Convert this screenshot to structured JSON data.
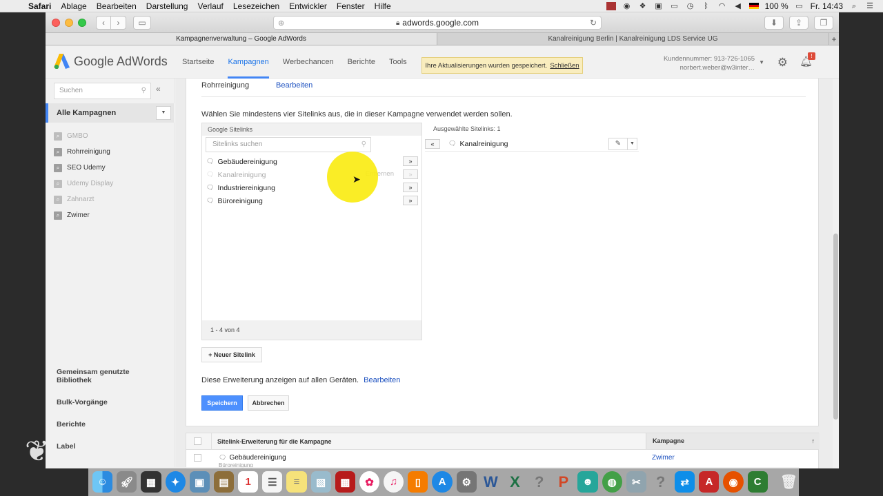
{
  "menubar": {
    "items": [
      "Safari",
      "Ablage",
      "Bearbeiten",
      "Darstellung",
      "Verlauf",
      "Lesezeichen",
      "Entwickler",
      "Fenster",
      "Hilfe"
    ],
    "battery": "100 %",
    "clock": "Fr. 14:43"
  },
  "browser": {
    "url": "adwords.google.com",
    "tabs": [
      {
        "title": "Kampagnenverwaltung – Google AdWords"
      },
      {
        "title": "Kanalreinigung Berlin | Kanalreinigung LDS Service UG"
      }
    ]
  },
  "header": {
    "logo_text": "Google AdWords",
    "nav": [
      "Startseite",
      "Kampagnen",
      "Werbechancen",
      "Berichte",
      "Tools"
    ],
    "notice_text": "Ihre Aktualisierungen wurden gespeichert.",
    "notice_link": "Schließen",
    "customer_number": "Kundennummer: 913-726-1065",
    "account_email": "norbert.weber@w3inter…",
    "notification_count": "!"
  },
  "sidebar": {
    "search_placeholder": "Suchen",
    "all_campaigns": "Alle Kampagnen",
    "campaigns": [
      {
        "name": "GMBO",
        "status": "paused"
      },
      {
        "name": "Rohrreinigung",
        "status": "enabled"
      },
      {
        "name": "SEO Udemy",
        "status": "enabled"
      },
      {
        "name": "Udemy Display",
        "status": "paused"
      },
      {
        "name": "Zahnarzt",
        "status": "paused"
      },
      {
        "name": "Zwimer",
        "status": "enabled"
      }
    ],
    "bottom_links": [
      "Gemeinsam genutzte Bibliothek",
      "Bulk-Vorgänge",
      "Berichte",
      "Label"
    ]
  },
  "main": {
    "campaign_name": "Rohrreinigung",
    "edit_link": "Bearbeiten",
    "instruction": "Wählen Sie mindestens vier Sitelinks aus, die in dieser Kampagne verwendet werden sollen.",
    "google_sitelinks": {
      "header": "Google Sitelinks",
      "search_placeholder": "Sitelinks suchen",
      "items": [
        {
          "label": "Gebäudereinigung",
          "dim": false
        },
        {
          "label": "Kanalreinigung",
          "dim": true,
          "ghost": "Entfernen"
        },
        {
          "label": "Industriereinigung",
          "dim": false
        },
        {
          "label": "Büroreinigung",
          "dim": false
        }
      ],
      "add_label": "»",
      "footer": "1 - 4 von 4"
    },
    "selected": {
      "label": "Ausgewählte Sitelinks: 1",
      "remove_label": "«",
      "items": [
        "Kanalreinigung"
      ]
    },
    "new_sitelink": "Neuer Sitelink",
    "device_text": "Diese Erweiterung anzeigen auf allen Geräten.",
    "device_edit": "Bearbeiten",
    "save": "Speichern",
    "cancel": "Abbrechen"
  },
  "table": {
    "col1": "Sitelink-Erweiterung für die Kampagne",
    "col2": "Kampagne",
    "rows": [
      {
        "sitelink": "Gebäudereinigung",
        "sub": "Büroreinigung",
        "campaign": "Zwimer"
      }
    ]
  }
}
